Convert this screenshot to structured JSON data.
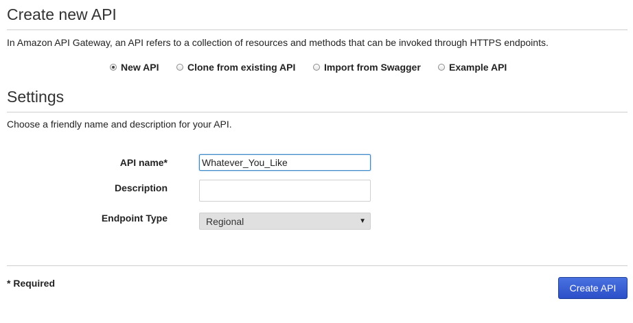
{
  "page": {
    "title": "Create new API",
    "intro": "In Amazon API Gateway, an API refers to a collection of resources and methods that can be invoked through HTTPS endpoints."
  },
  "api_source": {
    "options": [
      {
        "label": "New API",
        "checked": true
      },
      {
        "label": "Clone from existing API",
        "checked": false
      },
      {
        "label": "Import from Swagger",
        "checked": false
      },
      {
        "label": "Example API",
        "checked": false
      }
    ]
  },
  "settings": {
    "heading": "Settings",
    "description": "Choose a friendly name and description for your API.",
    "api_name": {
      "label": "API name*",
      "value": "Whatever_You_Like",
      "placeholder": ""
    },
    "description_field": {
      "label": "Description",
      "value": "",
      "placeholder": ""
    },
    "endpoint_type": {
      "label": "Endpoint Type",
      "selected": "Regional"
    }
  },
  "footer": {
    "required_note": "* Required",
    "create_button": "Create API"
  },
  "colors": {
    "primary_button": "#2b4fc8",
    "focus_border": "#3a87c8",
    "rule": "#cfcfcf"
  }
}
